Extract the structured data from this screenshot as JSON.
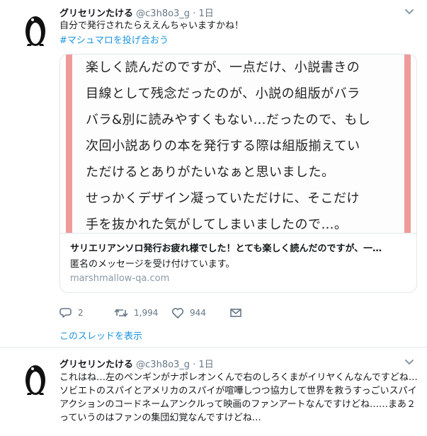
{
  "tweets": [
    {
      "name": "グリセリンたける",
      "handle": "@c3h8o3_g",
      "separator": "·",
      "time": "1日",
      "text": "自分で発行されたらええんちゃいますかね！",
      "hashtag": "#マシュマロを投げ合おう",
      "card": {
        "image_lines": [
          "楽しく読んだのですが、一点だけ、小説書きの",
          "目線として残念だったのが、小説の組版がバラ",
          "バラ&別に読みやすくもない…だったので、もし",
          "次回小説ありの本を発行する際は組版揃えてい",
          "ただけるとありがたいなぁと思いました。",
          "せっかくデザイン凝っていただけに、そこだけ",
          "手を抜かれた気がしてしまいましたので…。"
        ],
        "title": "サリエリアンソロ発行お疲れ様でした！とても楽しく読んだのですが、一…",
        "description": "匿名のメッセージを受け付けています。",
        "domain": "marshmallow-qa.com"
      },
      "actions": {
        "reply_count": "2",
        "retweet_count": "1,994",
        "like_count": "944"
      },
      "thread_link": "このスレッドを表示"
    },
    {
      "name": "グリセリンたける",
      "handle": "@c3h8o3_g",
      "separator": "·",
      "time": "1日",
      "text": "これはね…左のペンギンがナポレオンくんで右のしろくまがイリヤくんなんですどね…ソビエトのスパイとアメリカのスパイが喧嘩しつつ協力して世界を救うすっごいスパイアクションのコードネームアンクルって映画のファンアートなんですけどね……まあ２っていうのはファンの集団幻覚なんですけどね…"
    }
  ],
  "colors": {
    "link": "#1b95e0",
    "muted": "#657786",
    "card_accent": "#ee9a9b"
  },
  "icons": [
    "penguin-avatar",
    "chevron-down-icon",
    "reply-icon",
    "retweet-icon",
    "heart-icon",
    "envelope-icon"
  ]
}
